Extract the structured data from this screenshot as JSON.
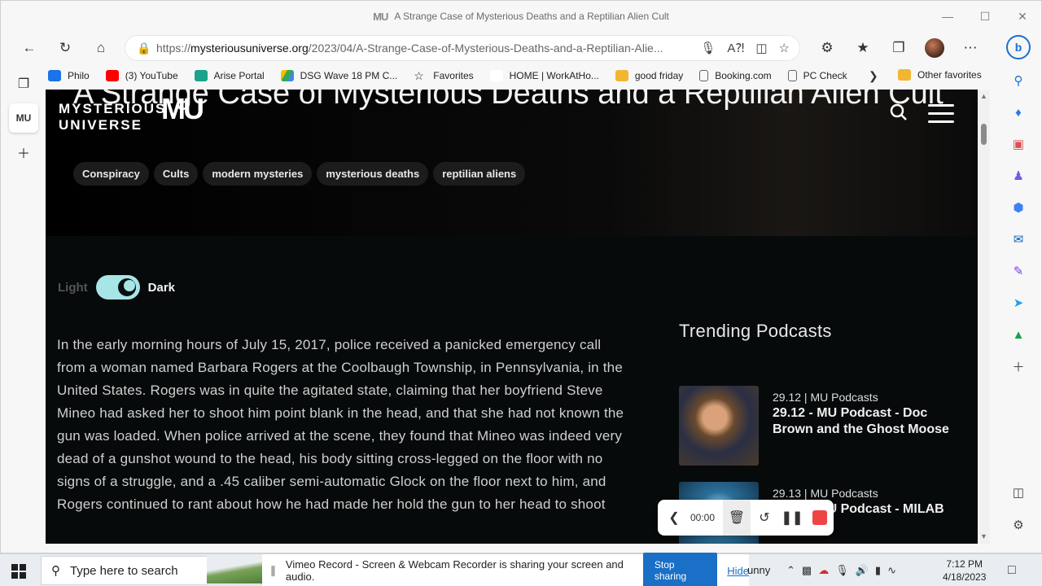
{
  "window": {
    "title": "A Strange Case of Mysterious Deaths and a Reptilian Alien Cult",
    "tab_logo": "MU"
  },
  "address_bar": {
    "url_prefix": "https://",
    "url_domain": "mysteriousuniverse.org",
    "url_path": "/2023/04/A-Strange-Case-of-Mysterious-Deaths-and-a-Reptilian-Alie..."
  },
  "favorites": [
    {
      "label": "Philo",
      "color": "#1a73e8"
    },
    {
      "label": "(3) YouTube",
      "color": "#ff0000"
    },
    {
      "label": "Arise Portal",
      "color": "#1aa38a"
    },
    {
      "label": "DSG Wave 18 PM C...",
      "color": "#34a853"
    },
    {
      "label": "Favorites",
      "color": "#444444"
    },
    {
      "label": "HOME | WorkAtHo...",
      "color": "#ffffff"
    },
    {
      "label": "good friday",
      "color": "#f2b632"
    },
    {
      "label": "Booking.com",
      "color": "#666666"
    },
    {
      "label": "PC Check",
      "color": "#666666"
    }
  ],
  "other_favorites": "Other favorites",
  "site": {
    "logo_line1": "MYSTERIOUS",
    "logo_line2": "UNIVERSE",
    "logo_mark": "MU",
    "title": "A Strange Case of Mysterious Deaths and a Reptilian Alien Cult",
    "tags": [
      "Conspiracy",
      "Cults",
      "modern mysteries",
      "mysterious deaths",
      "reptilian aliens"
    ],
    "theme_toggle": {
      "light": "Light",
      "dark": "Dark",
      "state": "dark"
    },
    "article_text": "In the early morning hours of July 15, 2017, police received a panicked emergency call from a woman named Barbara Rogers at the Coolbaugh Township, in Pennsylvania, in the United States. Rogers was in quite the agitated state, claiming that her boyfriend Steve Mineo had asked her to shoot him point blank in the head, and that she had not known the gun was loaded. When police arrived at the scene, they found that Mineo was indeed very dead of a gunshot wound to the head, his body sitting cross-legged on the floor with no signs of a struggle, and a .45 caliber semi-automatic Glock on the floor next to him, and Rogers continued to rant about how he had made her hold the gun to her head to shoot",
    "trending_title": "Trending Podcasts",
    "podcasts": [
      {
        "meta": "29.12  |  MU Podcasts",
        "title": "29.12 - MU Podcast - Doc Brown and the Ghost Moose"
      },
      {
        "meta": "29.13  |  MU Podcasts",
        "title": "29.13 - MU Podcast - MILAB"
      }
    ]
  },
  "recorder": {
    "time": "00:00"
  },
  "taskbar": {
    "search_placeholder": "Type here to search",
    "share_message": "Vimeo Record - Screen & Webcam Recorder is sharing your screen and audio.",
    "stop_sharing": "Stop sharing",
    "hide": "Hide",
    "weather_fragment": "unny",
    "time": "7:12 PM",
    "date": "4/18/2023"
  }
}
